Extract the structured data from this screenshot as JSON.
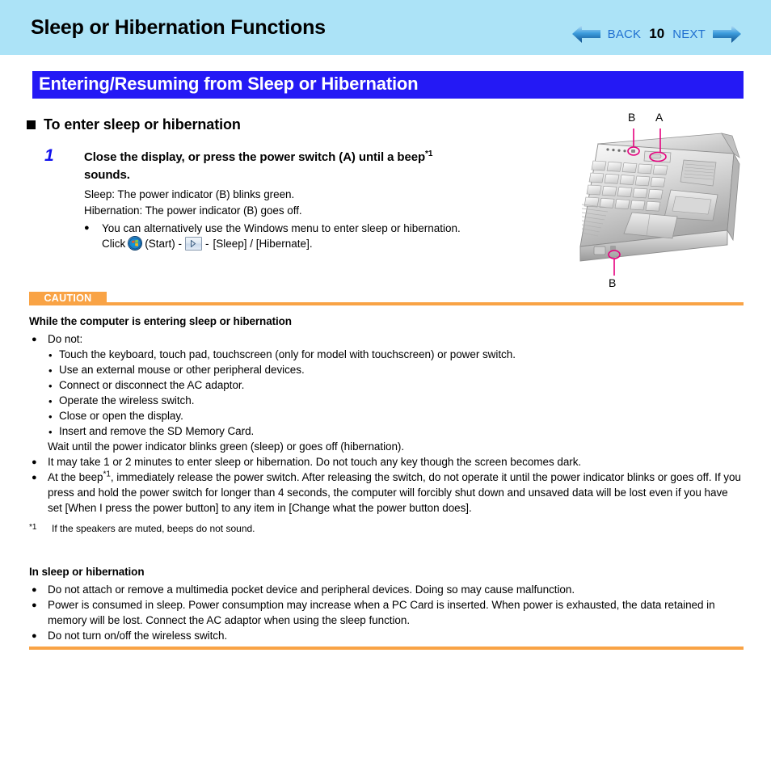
{
  "header": {
    "title": "Sleep or Hibernation Functions",
    "back_label": "BACK",
    "page_number": "10",
    "next_label": "NEXT",
    "band_color": "#ace3f7",
    "link_color": "#1f6fd0"
  },
  "section_bar": {
    "title": "Entering/Resuming from Sleep or Hibernation",
    "background": "#2419f5",
    "text_color": "#ffffff"
  },
  "subhead": {
    "text": "To enter sleep or hibernation"
  },
  "step": {
    "number": "1",
    "number_color": "#1111ee",
    "title_part1": "Close the display, or press the power switch (A) until a beep",
    "title_sup": "*1",
    "title_part2": "sounds.",
    "lines": [
      "Sleep: The power indicator (B) blinks green.",
      "Hibernation: The power indicator (B) goes off."
    ],
    "bullet": "You can alternatively use the Windows menu to enter sleep or hibernation.",
    "click_prefix": "Click",
    "click_start": "(Start) -",
    "click_dash": "-",
    "click_suffix": "[Sleep] / [Hibernate].",
    "start_icon": "windows-start-orb-icon",
    "arrow_button_icon": "triangle-right-icon"
  },
  "caution": {
    "badge": "CAUTION",
    "badge_color": "#f9a345",
    "heading": "While the computer is entering sleep or hibernation",
    "bullet1": "Do not:",
    "sub_items": [
      "Touch the keyboard, touch pad, touchscreen (only for model with touchscreen) or power switch.",
      "Use an external mouse or other peripheral devices.",
      "Connect or disconnect the AC adaptor.",
      "Operate the wireless switch.",
      "Close or open the display.",
      "Insert and remove the SD Memory Card."
    ],
    "wait_line": "Wait until the power indicator blinks green (sleep) or goes off (hibernation).",
    "bullet2": "It may take 1 or 2 minutes to enter sleep or hibernation. Do not touch any key though the screen becomes dark.",
    "bullet3_pre": "At the beep",
    "bullet3_sup": "*1",
    "bullet3_post": ", immediately release the power switch. After releasing the switch, do not operate it until the power indicator blinks or goes off. If you press and hold the power switch for longer than 4 seconds, the computer will forcibly shut down and unsaved data will be lost even if you have set [When I press the power button] to any item in [Change what the power button does].",
    "footnote_mark": "*1",
    "footnote_text": "If the speakers are muted, beeps do not sound."
  },
  "in_sleep": {
    "heading": "In sleep or hibernation",
    "bullets": [
      "Do not attach or remove a multimedia pocket device and peripheral devices. Doing so may cause malfunction.",
      "Power is consumed in sleep. Power consumption may increase when a PC Card is inserted. When power is exhausted, the data retained in memory will be lost. Connect the AC adaptor when using the sleep function.",
      "Do not turn on/off the wireless switch."
    ]
  },
  "illustration": {
    "name": "laptop-diagram",
    "callout_color": "#e6007e",
    "labels": {
      "b_top": "B",
      "a_top": "A",
      "b_bottom": "B"
    }
  }
}
